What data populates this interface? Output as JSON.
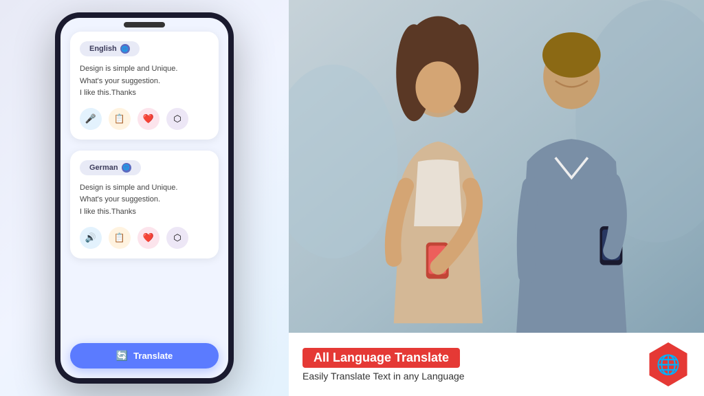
{
  "left": {
    "phone": {
      "source_card": {
        "language": "English",
        "text_line1": "Design is simple and Unique.",
        "text_line2": "What's your suggestion.",
        "text_line3": "I like this.Thanks",
        "buttons": [
          {
            "name": "mic",
            "icon": "🎤",
            "color_class": "btn-blue"
          },
          {
            "name": "copy",
            "icon": "📋",
            "color_class": "btn-orange"
          },
          {
            "name": "favorite",
            "icon": "❤️",
            "color_class": "btn-pink"
          },
          {
            "name": "share",
            "icon": "🔗",
            "color_class": "btn-purple"
          }
        ]
      },
      "target_card": {
        "language": "German",
        "text_line1": "Design is simple and Unique.",
        "text_line2": "What's your suggestion.",
        "text_line3": "I like this.Thanks",
        "buttons": [
          {
            "name": "speaker",
            "icon": "🔊",
            "color_class": "btn-blue"
          },
          {
            "name": "copy",
            "icon": "📋",
            "color_class": "btn-orange"
          },
          {
            "name": "favorite",
            "icon": "❤️",
            "color_class": "btn-pink"
          },
          {
            "name": "share",
            "icon": "🔗",
            "color_class": "btn-purple"
          }
        ]
      },
      "translate_button": "Translate"
    }
  },
  "right": {
    "banner": {
      "title": "All Language Translate",
      "subtitle": "Easily Translate Text in any  Language"
    }
  }
}
